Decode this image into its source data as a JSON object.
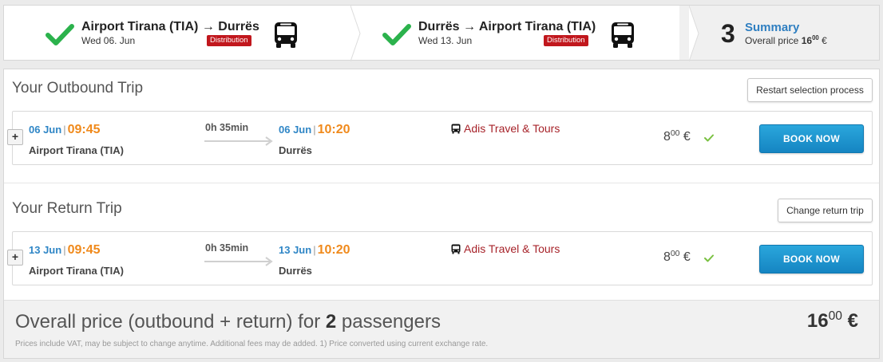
{
  "steps": [
    {
      "route": "Airport Tirana (TIA) → Durrës",
      "date": "Wed 06. Jun",
      "badge": "Distribution",
      "icon": "check-icon",
      "vehicle_icon": "bus-icon"
    },
    {
      "route": "Durrës → Airport Tirana (TIA)",
      "date": "Wed 13. Jun",
      "badge": "Distribution",
      "icon": "check-icon",
      "vehicle_icon": "bus-icon"
    },
    {
      "number": "3",
      "title": "Summary",
      "price_label": "Overall price",
      "price_main": "16",
      "price_cents": "00",
      "currency": "€"
    }
  ],
  "outbound": {
    "title": "Your Outbound Trip",
    "action_label": "Restart selection process",
    "expand_label": "+",
    "dep_date": "06 Jun",
    "dep_time": "09:45",
    "dep_stop": "Airport Tirana (TIA)",
    "duration": "0h 35min",
    "arr_date": "06 Jun",
    "arr_time": "10:20",
    "arr_stop": "Durrës",
    "operator": "Adis Travel & Tours",
    "price_main": "8",
    "price_cents": "00",
    "currency": "€",
    "book_label": "BOOK NOW"
  },
  "return": {
    "title": "Your Return Trip",
    "action_label": "Change return trip",
    "expand_label": "+",
    "dep_date": "13 Jun",
    "dep_time": "09:45",
    "dep_stop": "Airport Tirana (TIA)",
    "duration": "0h 35min",
    "arr_date": "13 Jun",
    "arr_time": "10:20",
    "arr_stop": "Durrës",
    "operator": "Adis Travel & Tours",
    "price_main": "8",
    "price_cents": "00",
    "currency": "€",
    "book_label": "BOOK NOW"
  },
  "total": {
    "label_prefix": "Overall price (outbound + return) for",
    "passengers": "2",
    "label_suffix": "passengers",
    "price_main": "16",
    "price_cents": "00",
    "currency": "€",
    "fine_print": "Prices include VAT, may be subject to change anytime. Additional fees may de added. 1) Price converted using current exchange rate."
  },
  "colors": {
    "accent_blue": "#2f86c6",
    "time_orange": "#f08a1c",
    "operator_red": "#a7232a",
    "badge_red": "#c1171d",
    "check_green": "#2bb24c",
    "book_blue": "#1a95d2"
  }
}
